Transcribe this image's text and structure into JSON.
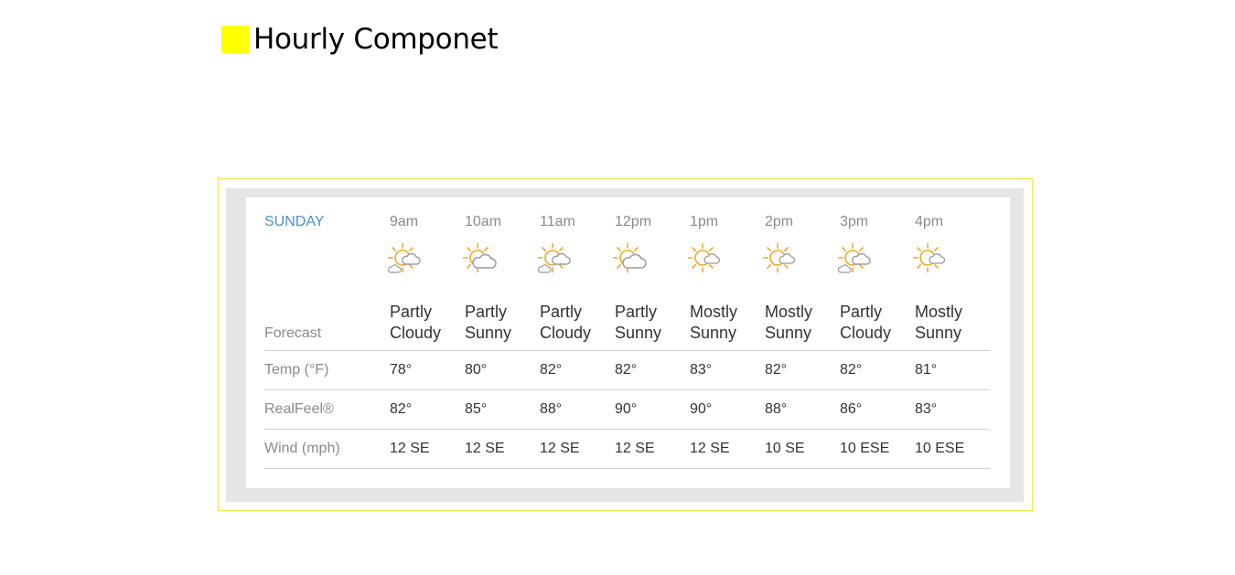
{
  "header": {
    "title": "Hourly Componet",
    "swatch_color": "#ffff00"
  },
  "widget": {
    "day": "SUNDAY",
    "forecast_label": "Forecast",
    "hours": [
      {
        "time": "9am",
        "icon": "partly-cloudy-icon",
        "condition": "Partly\nCloudy",
        "temp": "78°",
        "realfeel": "82°",
        "wind": "12 SE"
      },
      {
        "time": "10am",
        "icon": "partly-sunny-icon",
        "condition": "Partly\nSunny",
        "temp": "80°",
        "realfeel": "85°",
        "wind": "12 SE"
      },
      {
        "time": "11am",
        "icon": "partly-cloudy-icon",
        "condition": "Partly\nCloudy",
        "temp": "82°",
        "realfeel": "88°",
        "wind": "12 SE"
      },
      {
        "time": "12pm",
        "icon": "partly-sunny-icon",
        "condition": "Partly\nSunny",
        "temp": "82°",
        "realfeel": "90°",
        "wind": "12 SE"
      },
      {
        "time": "1pm",
        "icon": "mostly-sunny-icon",
        "condition": "Mostly\nSunny",
        "temp": "83°",
        "realfeel": "90°",
        "wind": "12 SE"
      },
      {
        "time": "2pm",
        "icon": "mostly-sunny-icon",
        "condition": "Mostly\nSunny",
        "temp": "82°",
        "realfeel": "88°",
        "wind": "10 SE"
      },
      {
        "time": "3pm",
        "icon": "partly-cloudy-icon",
        "condition": "Partly\nCloudy",
        "temp": "82°",
        "realfeel": "86°",
        "wind": "10 ESE"
      },
      {
        "time": "4pm",
        "icon": "mostly-sunny-icon",
        "condition": "Mostly\nSunny",
        "temp": "81°",
        "realfeel": "83°",
        "wind": "10 ESE"
      }
    ],
    "rows": [
      {
        "label": "Temp (°F)",
        "key": "temp"
      },
      {
        "label": "RealFeel®",
        "key": "realfeel"
      },
      {
        "label": "Wind (mph)",
        "key": "wind"
      }
    ]
  },
  "colors": {
    "day_label": "#4a90d9",
    "sun": "#f5a623",
    "cloud": "#9b9b9b",
    "frame_border": "#f2e94a",
    "widget_bg": "#e6e6e6"
  }
}
